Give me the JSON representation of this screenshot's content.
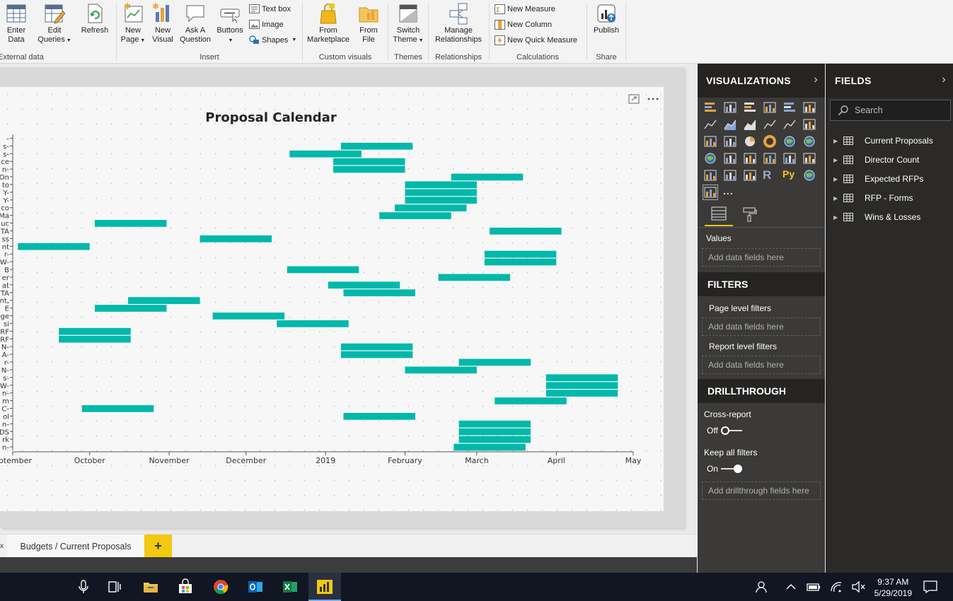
{
  "ribbon": {
    "buttons": {
      "enter_data": "Enter\nData",
      "edit_queries": "Edit\nQueries",
      "refresh": "Refresh",
      "new_page": "New\nPage",
      "new_visual": "New\nVisual",
      "ask_question": "Ask A\nQuestion",
      "buttons": "Buttons",
      "text_box": "Text box",
      "image": "Image",
      "shapes": "Shapes",
      "from_marketplace": "From\nMarketplace",
      "from_file": "From\nFile",
      "switch_theme": "Switch\nTheme",
      "manage_relationships": "Manage\nRelationships",
      "new_measure": "New Measure",
      "new_column": "New Column",
      "new_quick_measure": "New Quick Measure",
      "publish": "Publish"
    },
    "groups": {
      "external_data": "External data",
      "insert": "Insert",
      "custom_visuals": "Custom visuals",
      "themes": "Themes",
      "relationships": "Relationships",
      "calculations": "Calculations",
      "share": "Share"
    }
  },
  "visual": {
    "title": "Proposal Calendar",
    "focus_icon": "focus-mode-icon",
    "more_icon": "more-options-icon"
  },
  "chart_data": {
    "type": "bar",
    "orientation": "horizontal-timeline",
    "title": "Proposal Calendar",
    "bar_color": "#01b8aa",
    "x_ticks": [
      "eptember",
      "October",
      "November",
      "December",
      "2019",
      "February",
      "March",
      "April",
      "May"
    ],
    "y_labels": [
      "-",
      "s-",
      "s-",
      "ce",
      "n-",
      "On",
      "to",
      "Y-",
      "Y-",
      "co",
      "Ma",
      "uc",
      "TA",
      "ss",
      "nt",
      "r-",
      "W-",
      "B",
      "er",
      "at",
      "TA",
      "nt,",
      "E",
      "ge",
      "si",
      "RF",
      "RF",
      "N-",
      "A-",
      "r-",
      "N-",
      "s-",
      "W-",
      "n-",
      "m",
      "C-",
      "ol",
      "n-",
      "DS",
      "rk",
      "n-"
    ],
    "bars": [
      {
        "row": 1,
        "start": "2019-01-07",
        "end": "2019-02-04"
      },
      {
        "row": 2,
        "start": "2018-12-18",
        "end": "2019-01-15"
      },
      {
        "row": 3,
        "start": "2019-01-04",
        "end": "2019-02-01"
      },
      {
        "row": 4,
        "start": "2019-01-04",
        "end": "2019-02-01"
      },
      {
        "row": 5,
        "start": "2019-02-19",
        "end": "2019-03-19"
      },
      {
        "row": 6,
        "start": "2019-02-01",
        "end": "2019-03-01"
      },
      {
        "row": 7,
        "start": "2019-02-01",
        "end": "2019-03-01"
      },
      {
        "row": 8,
        "start": "2019-02-01",
        "end": "2019-03-01"
      },
      {
        "row": 9,
        "start": "2019-01-28",
        "end": "2019-02-25"
      },
      {
        "row": 10,
        "start": "2019-01-22",
        "end": "2019-02-19"
      },
      {
        "row": 11,
        "start": "2018-10-03",
        "end": "2018-10-31"
      },
      {
        "row": 12,
        "start": "2019-03-06",
        "end": "2019-04-03"
      },
      {
        "row": 13,
        "start": "2018-11-13",
        "end": "2018-12-11"
      },
      {
        "row": 14,
        "start": "2018-09-03",
        "end": "2018-10-01"
      },
      {
        "row": 15,
        "start": "2019-03-04",
        "end": "2019-04-01"
      },
      {
        "row": 16,
        "start": "2019-03-04",
        "end": "2019-04-01"
      },
      {
        "row": 17,
        "start": "2018-12-17",
        "end": "2019-01-14"
      },
      {
        "row": 18,
        "start": "2019-02-14",
        "end": "2019-03-14"
      },
      {
        "row": 19,
        "start": "2019-01-02",
        "end": "2019-01-30"
      },
      {
        "row": 20,
        "start": "2019-01-08",
        "end": "2019-02-05"
      },
      {
        "row": 21,
        "start": "2018-10-16",
        "end": "2018-11-13"
      },
      {
        "row": 22,
        "start": "2018-10-03",
        "end": "2018-10-31"
      },
      {
        "row": 23,
        "start": "2018-11-18",
        "end": "2018-12-16"
      },
      {
        "row": 24,
        "start": "2018-12-13",
        "end": "2019-01-10"
      },
      {
        "row": 25,
        "start": "2018-09-19",
        "end": "2018-10-17"
      },
      {
        "row": 26,
        "start": "2018-09-19",
        "end": "2018-10-17"
      },
      {
        "row": 27,
        "start": "2019-01-07",
        "end": "2019-02-04"
      },
      {
        "row": 28,
        "start": "2019-01-07",
        "end": "2019-02-04"
      },
      {
        "row": 29,
        "start": "2019-02-22",
        "end": "2019-03-22"
      },
      {
        "row": 30,
        "start": "2019-02-01",
        "end": "2019-03-01"
      },
      {
        "row": 31,
        "start": "2019-03-28",
        "end": "2019-04-25"
      },
      {
        "row": 32,
        "start": "2019-03-28",
        "end": "2019-04-25"
      },
      {
        "row": 33,
        "start": "2019-03-28",
        "end": "2019-04-25"
      },
      {
        "row": 34,
        "start": "2019-03-08",
        "end": "2019-04-05"
      },
      {
        "row": 35,
        "start": "2018-09-28",
        "end": "2018-10-26"
      },
      {
        "row": 36,
        "start": "2019-01-08",
        "end": "2019-02-05"
      },
      {
        "row": 37,
        "start": "2019-02-22",
        "end": "2019-03-22"
      },
      {
        "row": 38,
        "start": "2019-02-22",
        "end": "2019-03-22"
      },
      {
        "row": 39,
        "start": "2019-02-22",
        "end": "2019-03-22"
      },
      {
        "row": 40,
        "start": "2019-02-20",
        "end": "2019-03-20"
      }
    ],
    "xlim": [
      "2018-09-01",
      "2019-05-01"
    ]
  },
  "page_tabs": {
    "close": "x",
    "active_tab": "Budgets / Current Proposals",
    "add": "+"
  },
  "viz_pane": {
    "title": "VISUALIZATIONS",
    "values_label": "Values",
    "values_well": "Add data fields here",
    "filters_title": "FILTERS",
    "page_filters": "Page level filters",
    "page_filters_well": "Add data fields here",
    "report_filters": "Report level filters",
    "report_filters_well": "Add data fields here",
    "drillthrough_title": "DRILLTHROUGH",
    "cross_report": "Cross-report",
    "cross_report_state": "Off",
    "keep_all_filters": "Keep all filters",
    "keep_all_state": "On",
    "drillthrough_well": "Add drillthrough fields here",
    "r_label": "R",
    "py_label": "Py",
    "more": "..."
  },
  "fields_pane": {
    "title": "FIELDS",
    "search_placeholder": "Search",
    "tables": [
      "Current Proposals",
      "Director Count",
      "Expected RFPs",
      "RFP - Forms",
      "Wins & Losses"
    ]
  },
  "taskbar": {
    "time": "9:37 AM",
    "date": "5/29/2019"
  },
  "colors": {
    "accent_yellow": "#f2c811",
    "bar_teal": "#01b8aa",
    "pane_dark": "#3b3a39",
    "header_dark": "#252423"
  }
}
